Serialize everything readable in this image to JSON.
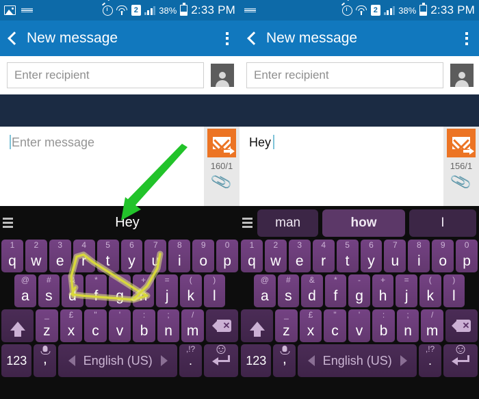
{
  "status_bar": {
    "icons_left": [
      "gallery-icon",
      "keyboard-icon"
    ],
    "icons_right": [
      "alarm-icon",
      "wifi-icon",
      "sim-icon",
      "signal-icon"
    ],
    "sim_label": "2",
    "battery_percent": "38%",
    "clock": "2:33 PM"
  },
  "app_bar": {
    "title": "New message",
    "back_icon": "back-chevron-icon",
    "overflow_icon": "overflow-menu-icon"
  },
  "recipient": {
    "placeholder": "Enter recipient",
    "value": "",
    "contact_icon": "contact-person-icon"
  },
  "left_panel": {
    "message": {
      "placeholder": "Enter message",
      "value": ""
    },
    "char_count": "160/1",
    "send_icon": "send-envelope-icon",
    "attach_icon": "paperclip-icon",
    "suggestion": "Hey"
  },
  "right_panel": {
    "message": {
      "placeholder": "Enter message",
      "value": "Hey"
    },
    "char_count": "156/1",
    "send_icon": "send-envelope-icon",
    "attach_icon": "paperclip-icon",
    "suggestions": [
      "man",
      "how",
      "I"
    ],
    "suggestion_selected": "how"
  },
  "keyboard": {
    "menu_icon": "hamburger-menu-icon",
    "row1": [
      {
        "key": "q",
        "sup": "1"
      },
      {
        "key": "w",
        "sup": "2"
      },
      {
        "key": "e",
        "sup": "3"
      },
      {
        "key": "r",
        "sup": "4"
      },
      {
        "key": "t",
        "sup": "5"
      },
      {
        "key": "y",
        "sup": "6"
      },
      {
        "key": "u",
        "sup": "7"
      },
      {
        "key": "i",
        "sup": "8"
      },
      {
        "key": "o",
        "sup": "9"
      },
      {
        "key": "p",
        "sup": "0"
      }
    ],
    "row2": [
      {
        "key": "a",
        "sup": "@"
      },
      {
        "key": "s",
        "sup": "#"
      },
      {
        "key": "d",
        "sup": "&"
      },
      {
        "key": "f",
        "sup": "*"
      },
      {
        "key": "g",
        "sup": "-"
      },
      {
        "key": "h",
        "sup": "+"
      },
      {
        "key": "j",
        "sup": "="
      },
      {
        "key": "k",
        "sup": "("
      },
      {
        "key": "l",
        "sup": ")"
      }
    ],
    "row3": [
      {
        "key": "z",
        "sup": "_"
      },
      {
        "key": "x",
        "sup": "£"
      },
      {
        "key": "c",
        "sup": "\""
      },
      {
        "key": "v",
        "sup": "'"
      },
      {
        "key": "b",
        "sup": ":"
      },
      {
        "key": "n",
        "sup": ";"
      },
      {
        "key": "m",
        "sup": "/"
      }
    ],
    "shift_icon": "shift-arrow-icon",
    "backspace_icon": "backspace-icon",
    "num_label": "123",
    "comma_label": ",",
    "mic_icon": "microphone-icon",
    "space_label": "English (US)",
    "space_prev_icon": "prev-language-arrow-icon",
    "space_next_icon": "next-language-arrow-icon",
    "period_label": ".",
    "period_sup": ",!?",
    "emoji_icon": "smiley-icon",
    "enter_icon": "enter-return-icon"
  },
  "annotations": {
    "arrow_color": "#22c32a",
    "arrow_name": "green-pointer-arrow",
    "swipe_trace_color": "#d8d83c",
    "swipe_trace_name": "swipe-gesture-trace"
  },
  "colors": {
    "status_bar": "#0d6aa8",
    "app_bar": "#1178be",
    "navy_strip": "#1b2b43",
    "send_orange": "#ec7424",
    "key_purple": "#6b3d7a",
    "keyboard_bg": "#0d0d0d"
  }
}
